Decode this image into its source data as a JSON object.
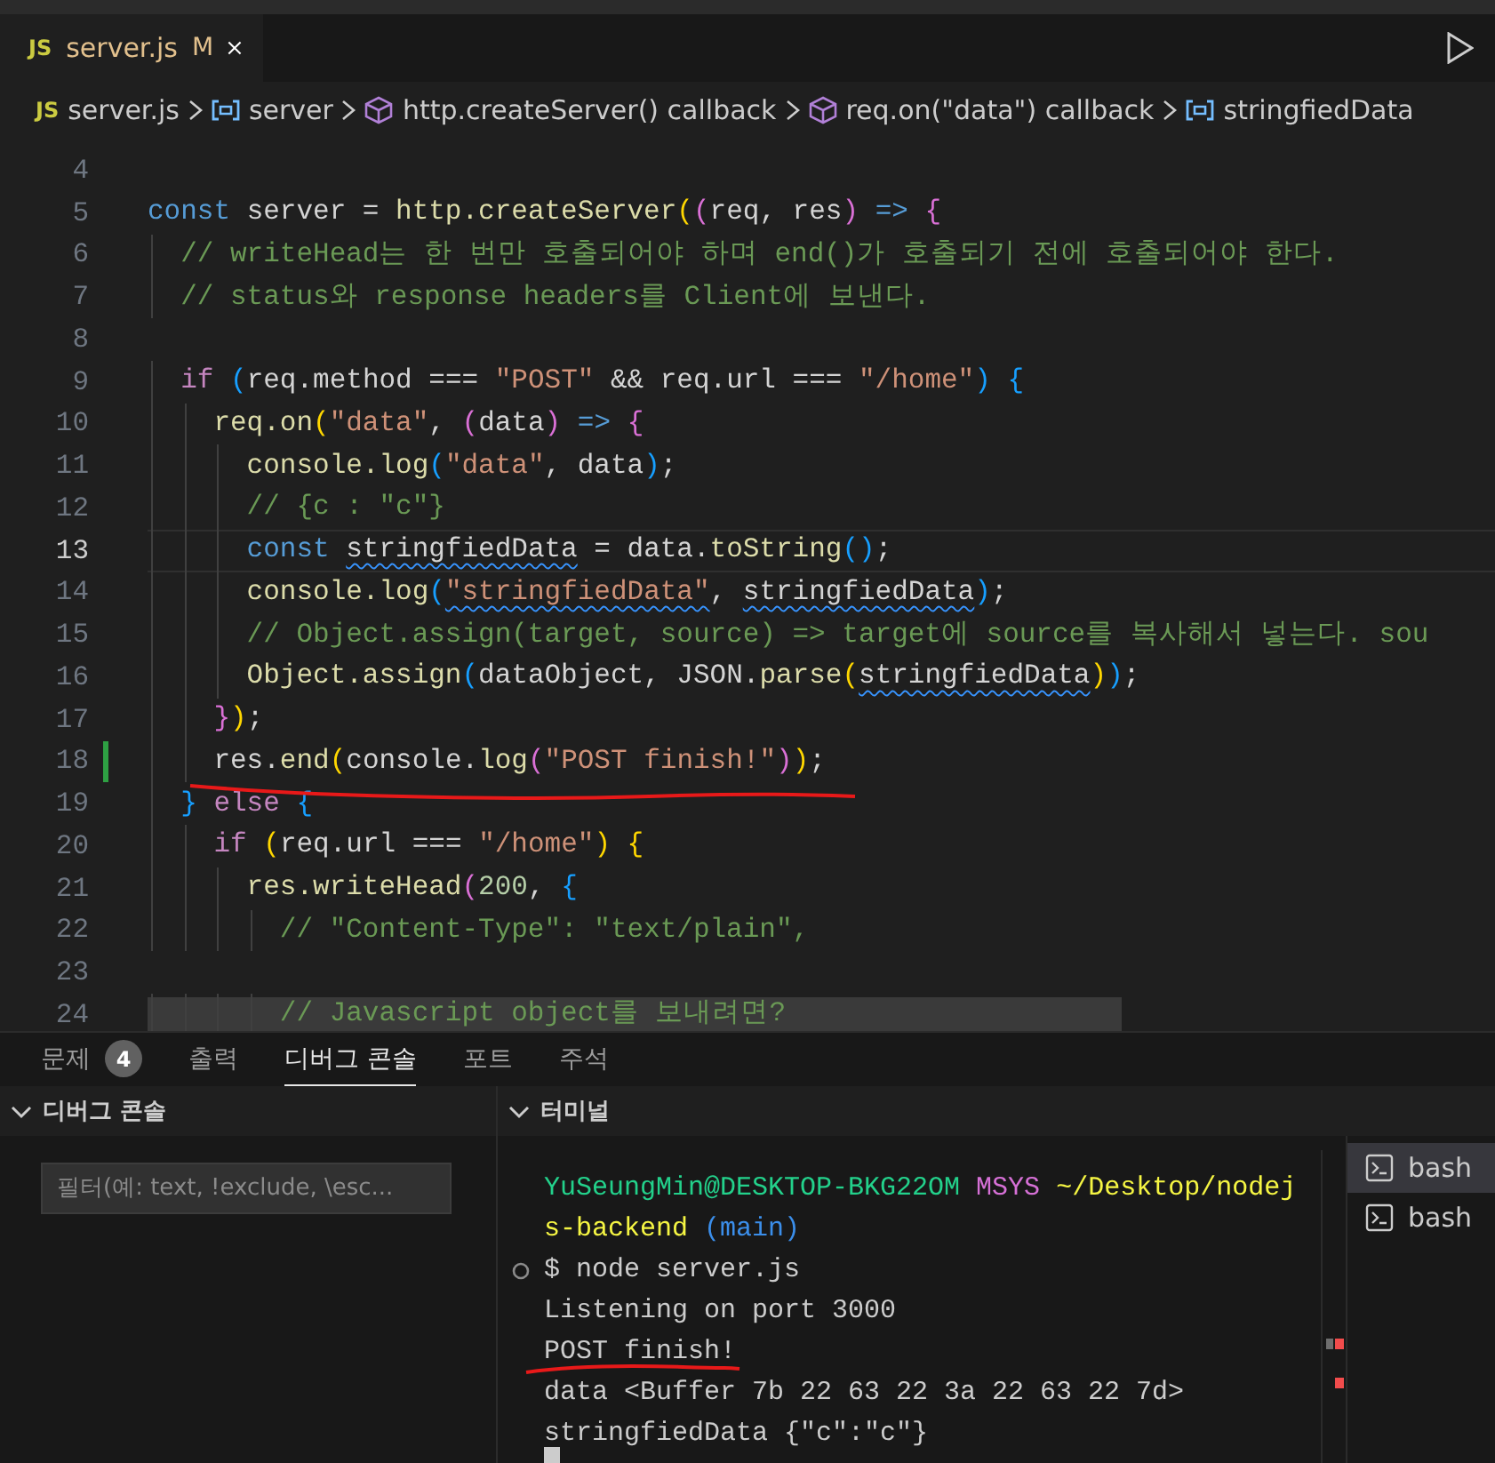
{
  "editor_tab": {
    "icon_text": "JS",
    "label": "server.js",
    "status": "M",
    "selected": true
  },
  "breadcrumbs": [
    {
      "kind": "file",
      "icon_text": "JS",
      "label": "server.js"
    },
    {
      "kind": "variable",
      "label": "server"
    },
    {
      "kind": "method",
      "label": "http.createServer() callback"
    },
    {
      "kind": "method",
      "label": "req.on(\"data\") callback"
    },
    {
      "kind": "variable",
      "label": "stringfiedData"
    }
  ],
  "code_lines": [
    {
      "number": "4",
      "current": false,
      "modified": false,
      "highlighted": false
    },
    {
      "number": "5",
      "current": false,
      "modified": false,
      "highlighted": false,
      "segments": [
        {
          "kind": "kw",
          "t": "const"
        },
        {
          "kind": "var",
          "t": " server = "
        },
        {
          "kind": "fn",
          "t": "http.createServer"
        },
        {
          "kind": "b1",
          "t": "("
        },
        {
          "kind": "b2",
          "t": "("
        },
        {
          "kind": "var",
          "t": "req, res"
        },
        {
          "kind": "b2",
          "t": ")"
        },
        {
          "kind": "kw",
          "t": " => "
        },
        {
          "kind": "b2",
          "t": "{"
        }
      ]
    },
    {
      "number": "6",
      "current": false,
      "modified": false,
      "highlighted": false,
      "segments": [
        {
          "kind": "cm",
          "t": "  // writeHead는 한 번만 호출되어야 하며 end()가 호출되기 전에 호출되어야 한다."
        }
      ]
    },
    {
      "number": "7",
      "current": false,
      "modified": false,
      "highlighted": false,
      "segments": [
        {
          "kind": "cm",
          "t": "  // status와 response headers를 Client에 보낸다."
        }
      ]
    },
    {
      "number": "8",
      "current": false,
      "modified": false,
      "highlighted": false
    },
    {
      "number": "9",
      "current": false,
      "modified": false,
      "highlighted": false,
      "segments": [
        {
          "kind": "ctl",
          "t": "  if "
        },
        {
          "kind": "b3",
          "t": "("
        },
        {
          "kind": "var",
          "t": "req.method === "
        },
        {
          "kind": "str",
          "t": "\"POST\""
        },
        {
          "kind": "var",
          "t": " && req.url === "
        },
        {
          "kind": "str",
          "t": "\"/home\""
        },
        {
          "kind": "b3",
          "t": ")"
        },
        {
          "kind": "b3",
          "t": " {"
        }
      ]
    },
    {
      "number": "10",
      "current": false,
      "modified": false,
      "highlighted": false,
      "segments": [
        {
          "kind": "fn",
          "t": "    req.on"
        },
        {
          "kind": "b1",
          "t": "("
        },
        {
          "kind": "str",
          "t": "\"data\""
        },
        {
          "kind": "var",
          "t": ", "
        },
        {
          "kind": "b2",
          "t": "("
        },
        {
          "kind": "var",
          "t": "data"
        },
        {
          "kind": "b2",
          "t": ")"
        },
        {
          "kind": "kw",
          "t": " => "
        },
        {
          "kind": "b2",
          "t": "{"
        }
      ]
    },
    {
      "number": "11",
      "current": false,
      "modified": false,
      "highlighted": false,
      "segments": [
        {
          "kind": "fn",
          "t": "      console.log"
        },
        {
          "kind": "b3",
          "t": "("
        },
        {
          "kind": "str",
          "t": "\"data\""
        },
        {
          "kind": "var",
          "t": ", data"
        },
        {
          "kind": "b3",
          "t": ")"
        },
        {
          "kind": "var",
          "t": ";"
        }
      ]
    },
    {
      "number": "12",
      "current": false,
      "modified": false,
      "highlighted": false,
      "segments": [
        {
          "kind": "cm",
          "t": "      // {c : \"c\"}"
        }
      ]
    },
    {
      "number": "13",
      "current": true,
      "modified": false,
      "highlighted": false,
      "segments": [
        {
          "kind": "kw",
          "t": "      const "
        },
        {
          "kind": "var",
          "t": "stringfiedData",
          "squiggle": true
        },
        {
          "kind": "var",
          "t": " = data."
        },
        {
          "kind": "fn",
          "t": "toString"
        },
        {
          "kind": "b3",
          "t": "()"
        },
        {
          "kind": "var",
          "t": ";"
        }
      ]
    },
    {
      "number": "14",
      "current": false,
      "modified": false,
      "highlighted": false,
      "segments": [
        {
          "kind": "fn",
          "t": "      console.log"
        },
        {
          "kind": "b3",
          "t": "("
        },
        {
          "kind": "str",
          "t": "\"stringfiedData\"",
          "squiggle": true
        },
        {
          "kind": "var",
          "t": ", "
        },
        {
          "kind": "var",
          "t": "stringfiedData",
          "squiggle": true
        },
        {
          "kind": "b3",
          "t": ")"
        },
        {
          "kind": "var",
          "t": ";"
        }
      ]
    },
    {
      "number": "15",
      "current": false,
      "modified": false,
      "highlighted": false,
      "segments": [
        {
          "kind": "cm",
          "t": "      // Object.assign(target, source) => target에 source를 복사해서 넣는다. sou"
        }
      ]
    },
    {
      "number": "16",
      "current": false,
      "modified": false,
      "highlighted": false,
      "segments": [
        {
          "kind": "fn",
          "t": "      Object.assign"
        },
        {
          "kind": "b3",
          "t": "("
        },
        {
          "kind": "var",
          "t": "dataObject, JSON."
        },
        {
          "kind": "fn",
          "t": "parse"
        },
        {
          "kind": "b1",
          "t": "("
        },
        {
          "kind": "var",
          "t": "stringfiedData",
          "squiggle": true
        },
        {
          "kind": "b1",
          "t": ")"
        },
        {
          "kind": "b3",
          "t": ")"
        },
        {
          "kind": "var",
          "t": ";"
        }
      ]
    },
    {
      "number": "17",
      "current": false,
      "modified": false,
      "highlighted": false,
      "segments": [
        {
          "kind": "b2",
          "t": "    }"
        },
        {
          "kind": "b1",
          "t": ")"
        },
        {
          "kind": "var",
          "t": ";"
        }
      ]
    },
    {
      "number": "18",
      "current": false,
      "modified": true,
      "highlighted": false,
      "segments": [
        {
          "kind": "var",
          "t": "    res."
        },
        {
          "kind": "fn",
          "t": "end"
        },
        {
          "kind": "b1",
          "t": "("
        },
        {
          "kind": "var",
          "t": "console."
        },
        {
          "kind": "fn",
          "t": "log"
        },
        {
          "kind": "b2",
          "t": "("
        },
        {
          "kind": "str",
          "t": "\"POST finish!\""
        },
        {
          "kind": "b2",
          "t": ")"
        },
        {
          "kind": "b1",
          "t": ")"
        },
        {
          "kind": "var",
          "t": ";"
        }
      ]
    },
    {
      "number": "19",
      "current": false,
      "modified": false,
      "highlighted": false,
      "segments": [
        {
          "kind": "b3",
          "t": "  }"
        },
        {
          "kind": "ctl",
          "t": " else "
        },
        {
          "kind": "b3",
          "t": "{"
        }
      ]
    },
    {
      "number": "20",
      "current": false,
      "modified": false,
      "highlighted": false,
      "segments": [
        {
          "kind": "ctl",
          "t": "    if "
        },
        {
          "kind": "b1",
          "t": "("
        },
        {
          "kind": "var",
          "t": "req.url === "
        },
        {
          "kind": "str",
          "t": "\"/home\""
        },
        {
          "kind": "b1",
          "t": ")"
        },
        {
          "kind": "b1",
          "t": " {"
        }
      ]
    },
    {
      "number": "21",
      "current": false,
      "modified": false,
      "highlighted": false,
      "segments": [
        {
          "kind": "fn",
          "t": "      res.writeHead"
        },
        {
          "kind": "b2",
          "t": "("
        },
        {
          "kind": "num",
          "t": "200"
        },
        {
          "kind": "var",
          "t": ", "
        },
        {
          "kind": "b3",
          "t": "{"
        }
      ]
    },
    {
      "number": "22",
      "current": false,
      "modified": false,
      "highlighted": false,
      "segments": [
        {
          "kind": "cm",
          "t": "        // \"Content-Type\": \"text/plain\","
        }
      ]
    },
    {
      "number": "23",
      "current": false,
      "modified": false,
      "highlighted": false
    },
    {
      "number": "24",
      "current": false,
      "modified": false,
      "highlighted": true,
      "segments": [
        {
          "kind": "cm",
          "t": "        // Javascript object를 보내려면?"
        }
      ]
    }
  ],
  "panel_tabs": [
    {
      "label": "문제",
      "badge": "4",
      "selected": false
    },
    {
      "label": "출력",
      "selected": false
    },
    {
      "label": "디버그 콘솔",
      "selected": true
    },
    {
      "label": "포트",
      "selected": false
    },
    {
      "label": "주석",
      "selected": false
    }
  ],
  "debug_console": {
    "title": "디버그 콘솔",
    "filter": {
      "placeholder": "필터(예: text, !exclude, \\esc..."
    }
  },
  "terminal": {
    "title": "터미널",
    "lines": [
      {
        "prompt_mark": false,
        "segments": [
          {
            "kind": "green",
            "t": "YuSeungMin@DESKTOP-BKG22OM "
          },
          {
            "kind": "magenta",
            "t": "MSYS "
          },
          {
            "kind": "yellow",
            "t": "~/Desktop/nodej"
          }
        ]
      },
      {
        "prompt_mark": false,
        "segments": [
          {
            "kind": "yellow",
            "t": "s-backend "
          },
          {
            "kind": "cyan",
            "t": "(main)"
          }
        ]
      },
      {
        "prompt_mark": true,
        "segments": [
          {
            "kind": "plain",
            "t": "$ node server.js"
          }
        ]
      },
      {
        "prompt_mark": false,
        "segments": [
          {
            "kind": "plain",
            "t": "Listening on port 3000"
          }
        ]
      },
      {
        "prompt_mark": false,
        "segments": [
          {
            "kind": "plain",
            "t": "POST finish!"
          }
        ]
      },
      {
        "prompt_mark": false,
        "segments": [
          {
            "kind": "plain",
            "t": "data <Buffer 7b 22 63 22 3a 22 63 22 7d>"
          }
        ]
      },
      {
        "prompt_mark": false,
        "segments": [
          {
            "kind": "plain",
            "t": "stringfiedData {\"c\":\"c\"}"
          }
        ]
      }
    ],
    "sessions": [
      {
        "label": "bash",
        "selected": true
      },
      {
        "label": "bash",
        "selected": false
      }
    ]
  }
}
